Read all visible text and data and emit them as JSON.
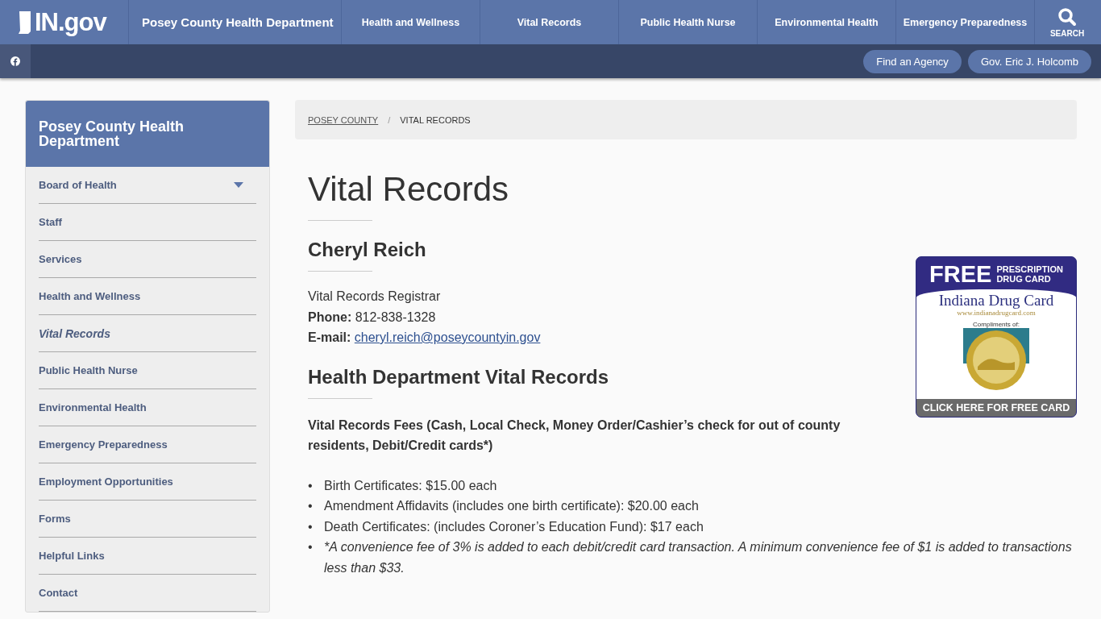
{
  "header": {
    "logo": "IN.gov",
    "site_title": "Posey County Health Department",
    "nav": [
      {
        "label": "Health and Wellness"
      },
      {
        "label": "Vital Records"
      },
      {
        "label": "Public Health Nurse"
      },
      {
        "label": "Environmental Health"
      },
      {
        "label": "Emergency Preparedness"
      }
    ],
    "search_label": "SEARCH"
  },
  "utility_bar": {
    "buttons": [
      "Find an Agency",
      "Gov. Eric J. Holcomb"
    ]
  },
  "sidebar": {
    "title": "Posey County Health Department",
    "items": [
      {
        "label": "Board of Health",
        "selected": false,
        "has_submenu": true
      },
      {
        "label": "Staff",
        "selected": false,
        "has_submenu": false
      },
      {
        "label": "Services",
        "selected": false,
        "has_submenu": false
      },
      {
        "label": "Health and Wellness",
        "selected": false,
        "has_submenu": false
      },
      {
        "label": "Vital Records",
        "selected": true,
        "has_submenu": false
      },
      {
        "label": "Public Health Nurse",
        "selected": false,
        "has_submenu": false
      },
      {
        "label": "Environmental Health",
        "selected": false,
        "has_submenu": false
      },
      {
        "label": "Emergency Preparedness",
        "selected": false,
        "has_submenu": false
      },
      {
        "label": "Employment Opportunities",
        "selected": false,
        "has_submenu": false
      },
      {
        "label": "Forms",
        "selected": false,
        "has_submenu": false
      },
      {
        "label": "Helpful Links",
        "selected": false,
        "has_submenu": false
      },
      {
        "label": "Contact",
        "selected": false,
        "has_submenu": false
      }
    ]
  },
  "breadcrumb": [
    {
      "label": "POSEY COUNTY",
      "link": true
    },
    {
      "label": "VITAL RECORDS",
      "link": false
    }
  ],
  "breadcrumb_separator": "/",
  "bullet": "•",
  "page_title": "Vital Records",
  "contact": {
    "heading": "Cheryl Reich",
    "role": "Vital Records Registrar",
    "phone_label": "Phone:",
    "phone": "812-838-1328",
    "email_label": "E-mail:",
    "email": "cheryl.reich@poseycountyin.gov"
  },
  "ad": {
    "free": "FREE",
    "line1": "PRESCRIPTION",
    "line2": "DRUG CARD",
    "brand": "Indiana Drug Card",
    "url": "www.indianadrugcard.com",
    "compliments": "Compliments of:",
    "cta": "CLICK HERE FOR FREE CARD"
  },
  "section": {
    "heading": "Health Department Vital Records",
    "fees_intro": "Vital Records Fees (Cash, Local Check, Money Order/Cashier’s check for out of county residents, Debit/Credit cards*)",
    "fees": [
      {
        "kind": "fee",
        "text": "Birth Certificates: $15.00 each"
      },
      {
        "kind": "fee",
        "text": "Amendment Affidavits (includes one birth certificate): $20.00 each"
      },
      {
        "kind": "fee",
        "text": "Death Certificates: (includes Coroner’s Education Fund): $17 each"
      },
      {
        "kind": "note",
        "text": "*A convenience fee of 3% is added to each debit/credit card transaction. A minimum convenience fee of $1 is added to transactions less than $33."
      }
    ]
  }
}
